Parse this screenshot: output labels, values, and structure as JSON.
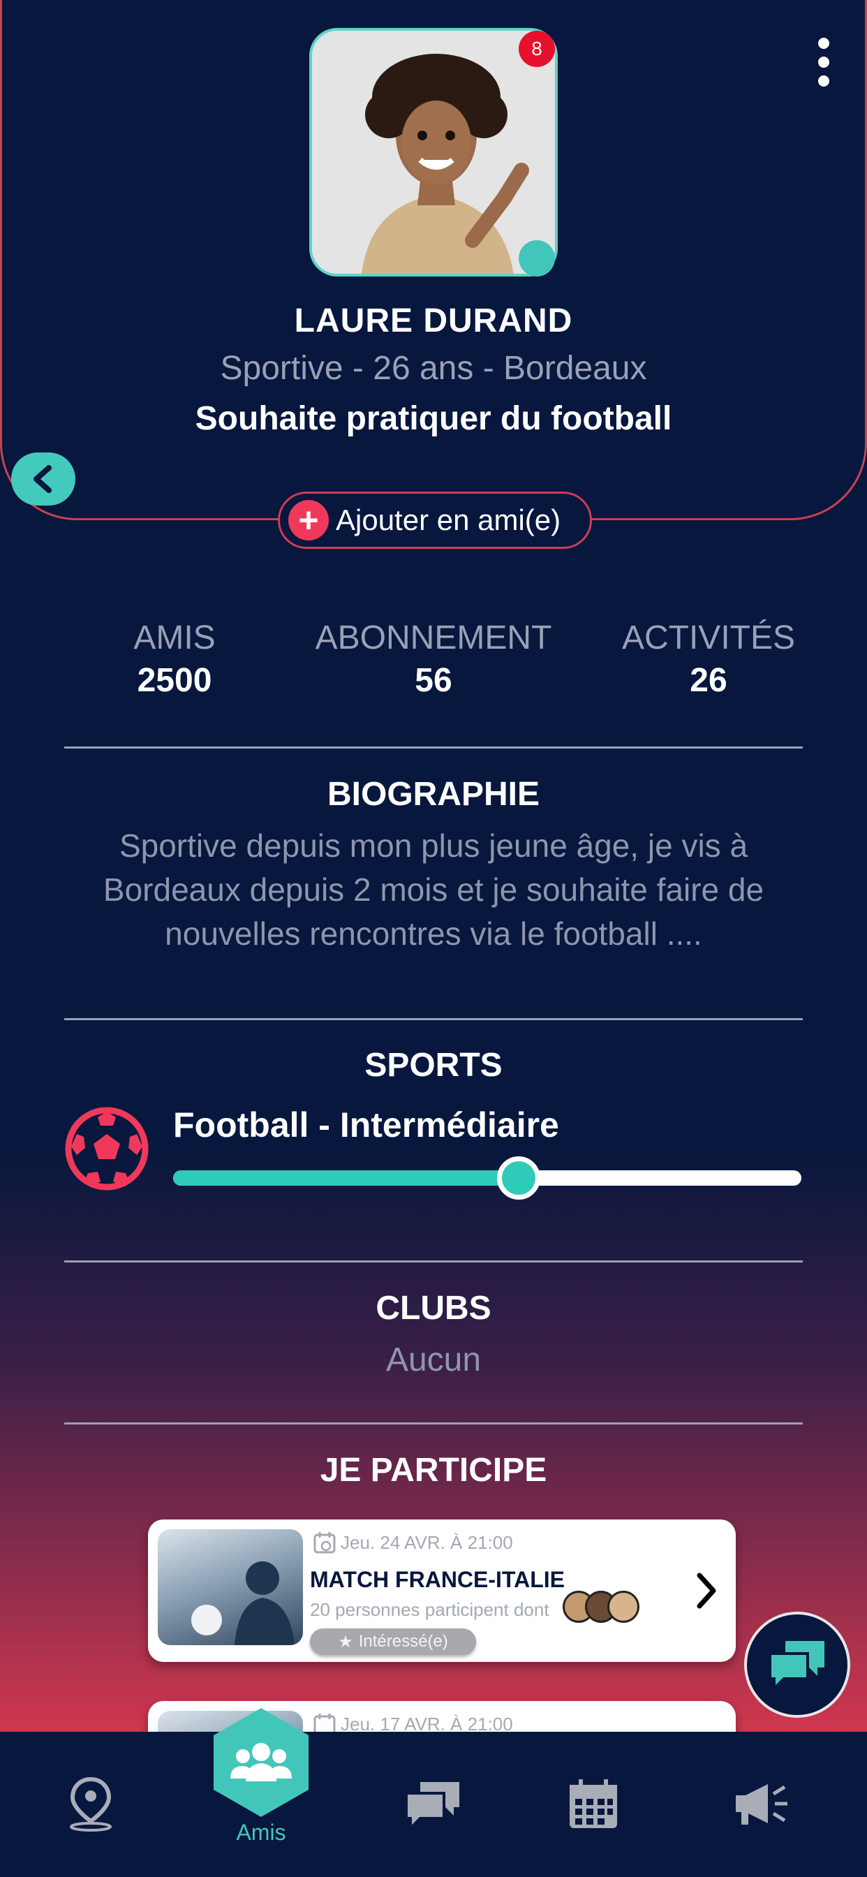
{
  "profile": {
    "badge_count": "8",
    "name": "LAURE DURAND",
    "subtitle": "Sportive - 26 ans - Bordeaux",
    "wish": "Souhaite pratiquer du football",
    "add_friend_label": "Ajouter en ami(e)"
  },
  "stats": [
    {
      "label": "AMIS",
      "value": "2500"
    },
    {
      "label": "ABONNEMENT",
      "value": "56"
    },
    {
      "label": "ACTIVITÉS",
      "value": "26"
    }
  ],
  "biography": {
    "title": "BIOGRAPHIE",
    "text": "Sportive depuis mon plus jeune âge, je vis à Bordeaux depuis 2 mois et je souhaite faire de nouvelles rencontres via le football ...."
  },
  "sports": {
    "title": "SPORTS",
    "items": [
      {
        "label": "Football - Intermédiaire",
        "level_percent": 55,
        "icon": "soccer-ball-icon"
      }
    ]
  },
  "clubs": {
    "title": "CLUBS",
    "value": "Aucun"
  },
  "participations": {
    "title": "JE PARTICIPE",
    "events": [
      {
        "date": "Jeu. 24 AVR. À 21:00",
        "title": "MATCH FRANCE-ITALIE",
        "participants": "20 personnes participent dont",
        "interest": "Intéressé(e)"
      },
      {
        "date": "Jeu. 17 AVR. À 21:00"
      }
    ]
  },
  "nav": {
    "items": [
      {
        "icon": "map-pin-icon"
      },
      {
        "icon": "friends-icon",
        "label": "Amis",
        "active": true
      },
      {
        "icon": "messages-icon"
      },
      {
        "icon": "calendar-icon"
      },
      {
        "icon": "megaphone-icon"
      }
    ]
  },
  "colors": {
    "background": "#07173d",
    "accent_teal": "#43c6ba",
    "accent_red": "#f0395a",
    "muted_text": "#9aa1b6"
  }
}
